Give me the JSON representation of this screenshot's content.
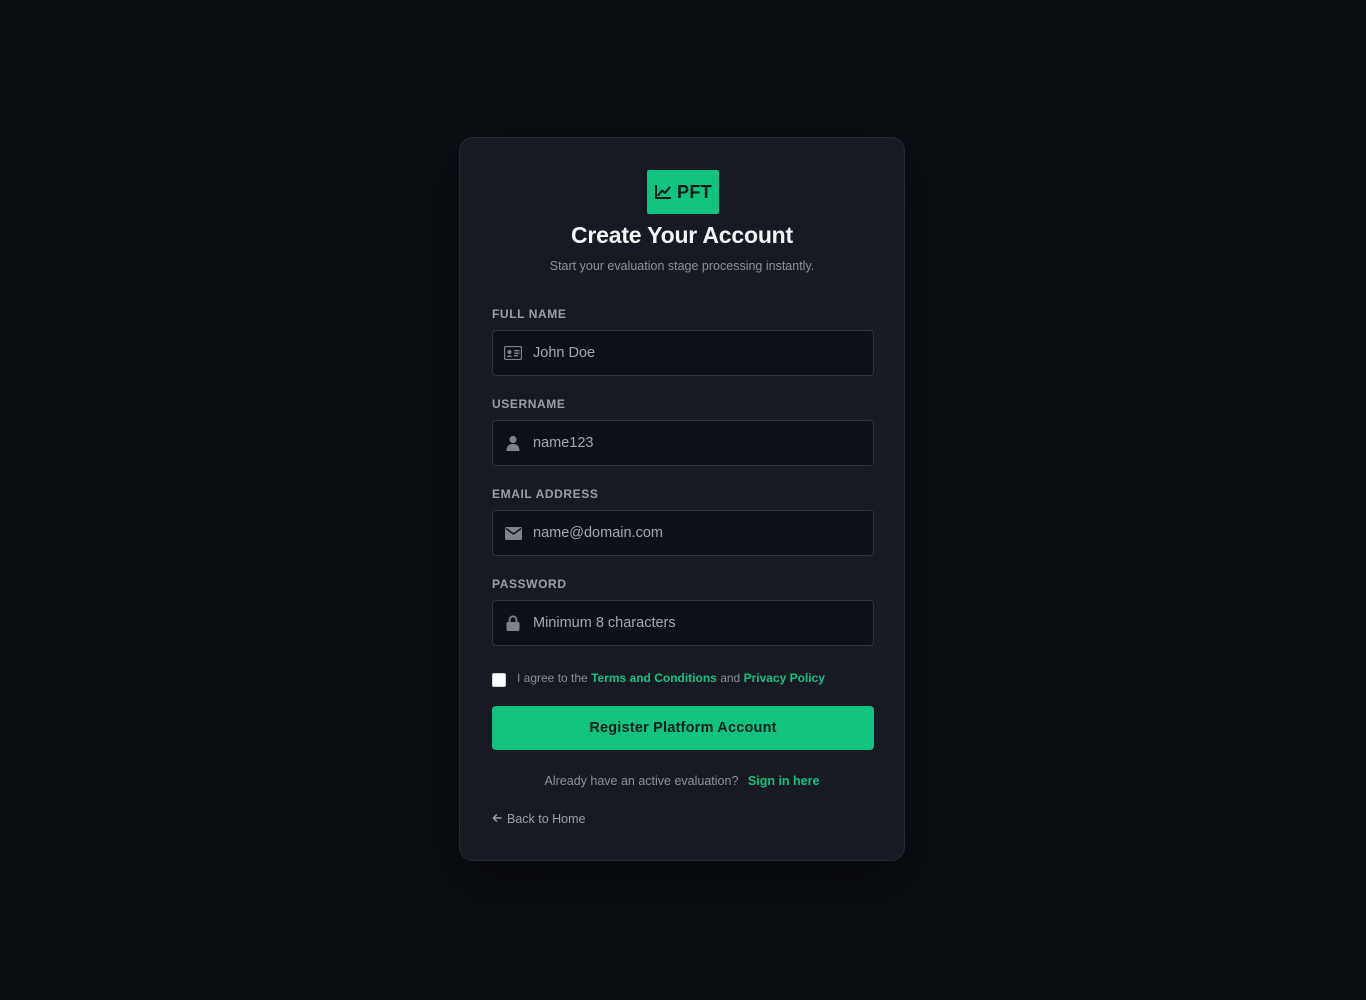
{
  "logo": {
    "text": "PFT",
    "icon": "chart-line-icon"
  },
  "header": {
    "title": "Create Your Account",
    "subtitle": "Start your evaluation stage processing instantly."
  },
  "form": {
    "full_name": {
      "label": "FULL NAME",
      "placeholder": "John Doe",
      "icon": "id-card-icon"
    },
    "username": {
      "label": "USERNAME",
      "placeholder": "name123",
      "icon": "user-icon"
    },
    "email": {
      "label": "EMAIL ADDRESS",
      "placeholder": "name@domain.com",
      "icon": "envelope-icon"
    },
    "password": {
      "label": "PASSWORD",
      "placeholder": "Minimum 8 characters",
      "icon": "lock-icon"
    },
    "agree": {
      "prefix": "I agree to the",
      "terms": "Terms and Conditions",
      "middle": "and",
      "privacy": "Privacy Policy",
      "checked": false
    },
    "submit_label": "Register Platform Account"
  },
  "footer": {
    "signin_prompt": "Already have an active evaluation?",
    "signin_link": "Sign in here",
    "back_label": "Back to Home"
  },
  "colors": {
    "accent": "#10c47f",
    "background": "#0b0e13",
    "card": "#171a22",
    "input_bg": "#0d1016"
  }
}
